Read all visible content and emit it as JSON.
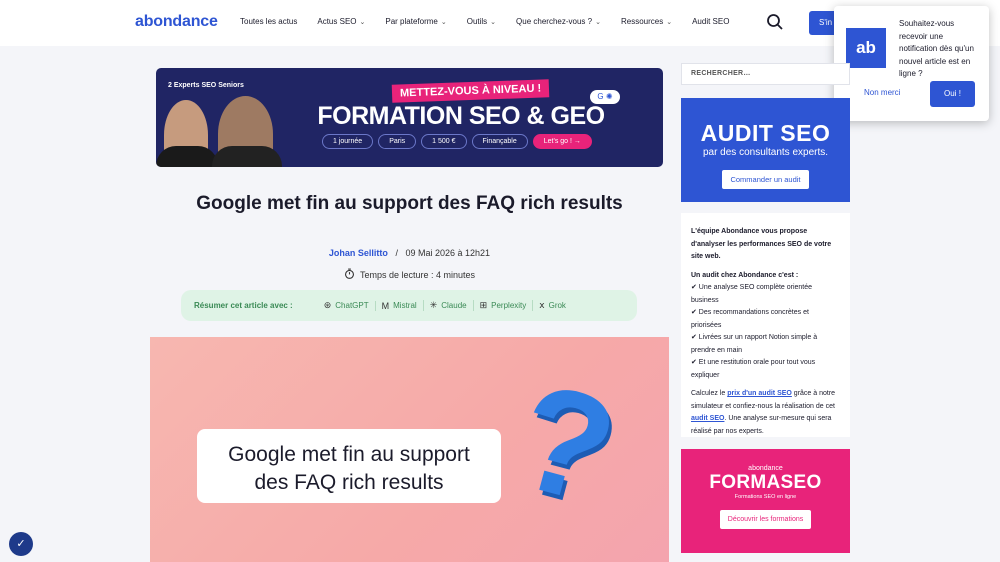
{
  "header": {
    "logo": "abondance",
    "nav": [
      {
        "label": "Toutes les actus",
        "has_dropdown": false
      },
      {
        "label": "Actus SEO",
        "has_dropdown": true
      },
      {
        "label": "Par plateforme",
        "has_dropdown": true
      },
      {
        "label": "Outils",
        "has_dropdown": true
      },
      {
        "label": "Que cherchez-vous ?",
        "has_dropdown": true
      },
      {
        "label": "Ressources",
        "has_dropdown": true
      },
      {
        "label": "Audit SEO",
        "has_dropdown": false
      }
    ],
    "signin_label": "S'in",
    "search_icon": "search-icon"
  },
  "notification": {
    "logo": "ab",
    "text": "Souhaitez-vous recevoir une notification dès qu'un nouvel article est en ligne ?",
    "no_label": "Non merci",
    "yes_label": "Oui !"
  },
  "banner": {
    "experts": "2 Experts SEO Seniors",
    "tag": "METTEZ-VOUS À NIVEAU !",
    "title": "FORMATION SEO & GEO",
    "pills": [
      "1 journée",
      "Paris",
      "1 500 €",
      "Finançable"
    ],
    "cta": "Let's go ! →"
  },
  "article": {
    "title": "Google met fin au support des FAQ rich results",
    "author": "Johan Sellitto",
    "separator": "/",
    "date": "09 Mai 2026 à 12h21",
    "readtime": "Temps de lecture : 4 minutes",
    "summary_label": "Résumer cet article avec :",
    "ai_tools": [
      "ChatGPT",
      "Mistral",
      "Claude",
      "Perplexity",
      "Grok"
    ],
    "hero_text_line1": "Google met fin au support",
    "hero_text_line2": "des FAQ rich results"
  },
  "sidebar": {
    "search_placeholder": "RECHERCHER…",
    "audit": {
      "title": "AUDIT SEO",
      "subtitle": "par des consultants experts.",
      "button": "Commander un audit"
    },
    "text": {
      "intro": "L'équipe Abondance vous propose d'analyser les performances SEO de votre site web.",
      "list_title": "Un audit chez Abondance c'est :",
      "items": [
        "✔ Une analyse SEO complète orientée business",
        "✔ Des recommandations concrètes et priorisées",
        "✔ Livrées sur un rapport Notion simple à prendre en main",
        "✔ Et une restitution orale pour tout vous expliquer"
      ],
      "p_start": "Calculez le ",
      "p_link1": "prix d'un audit SEO",
      "p_mid": " grâce à notre simulateur et confiez-nous la réalisation de cet ",
      "p_link2": "audit SEO",
      "p_end": ". Une analyse sur-mesure qui sera réalisé par nos experts."
    },
    "formaseo": {
      "brand": "abondance",
      "title": "FORMASEO",
      "subtitle": "Formations SEO en ligne",
      "button": "Découvrir les formations"
    }
  },
  "colors": {
    "brand_blue": "#2e55d3",
    "pink": "#e8237a",
    "banner_navy": "#202564",
    "summary_green_bg": "#dff3e6"
  }
}
